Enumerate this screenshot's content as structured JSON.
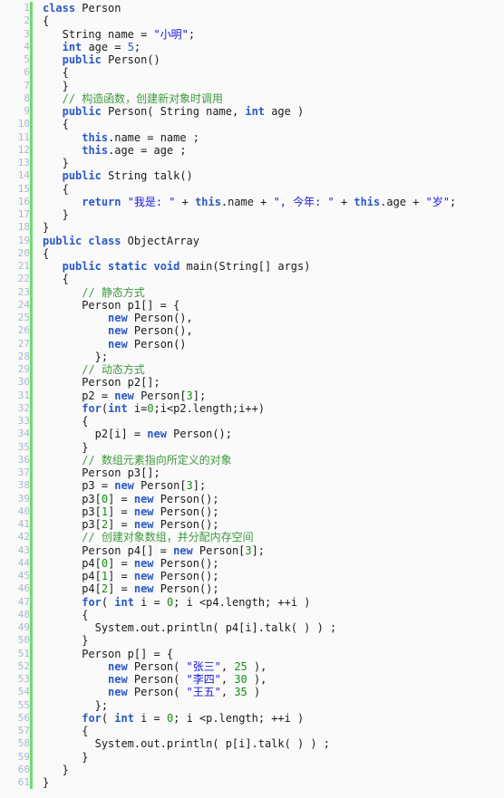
{
  "editor": {
    "file_name": "ObjectArray.java",
    "language": "Java",
    "background_color": "#fafafa",
    "gutter_color": "#a5b6cc",
    "marker_color": "#6ddd6d",
    "keyword_color": "#2a58c8",
    "string_color": "#1818e0",
    "comment_color": "#3c9a3c",
    "number_color": "#109010",
    "plain_color": "#1a1a1a",
    "first_line": 1,
    "last_line": 61,
    "total_lines": 61
  },
  "lines": [
    {
      "n": "1",
      "tokens": [
        {
          "t": "kw",
          "v": "class"
        },
        {
          "t": "pln",
          "v": " Person"
        }
      ]
    },
    {
      "n": "2",
      "tokens": [
        {
          "t": "pln",
          "v": "{"
        }
      ]
    },
    {
      "n": "3",
      "tokens": [
        {
          "t": "pln",
          "v": "   String name = "
        },
        {
          "t": "str",
          "v": "\"小明\""
        },
        {
          "t": "pln",
          "v": ";"
        }
      ]
    },
    {
      "n": "4",
      "tokens": [
        {
          "t": "pln",
          "v": "   "
        },
        {
          "t": "kw",
          "v": "int"
        },
        {
          "t": "pln",
          "v": " age = "
        },
        {
          "t": "numb",
          "v": "5"
        },
        {
          "t": "pln",
          "v": ";"
        }
      ]
    },
    {
      "n": "5",
      "tokens": [
        {
          "t": "pln",
          "v": "   "
        },
        {
          "t": "kw",
          "v": "public"
        },
        {
          "t": "pln",
          "v": " Person()"
        }
      ]
    },
    {
      "n": "6",
      "tokens": [
        {
          "t": "pln",
          "v": "   {"
        }
      ]
    },
    {
      "n": "7",
      "tokens": [
        {
          "t": "pln",
          "v": "   }"
        }
      ]
    },
    {
      "n": "8",
      "tokens": [
        {
          "t": "pln",
          "v": "   "
        },
        {
          "t": "cmt",
          "v": "// 构造函数，创建新对象时调用"
        }
      ]
    },
    {
      "n": "9",
      "tokens": [
        {
          "t": "pln",
          "v": "   "
        },
        {
          "t": "kw",
          "v": "public"
        },
        {
          "t": "pln",
          "v": " Person( String name, "
        },
        {
          "t": "kw",
          "v": "int"
        },
        {
          "t": "pln",
          "v": " age )"
        }
      ]
    },
    {
      "n": "10",
      "tokens": [
        {
          "t": "pln",
          "v": "   {"
        }
      ]
    },
    {
      "n": "11",
      "tokens": [
        {
          "t": "pln",
          "v": "      "
        },
        {
          "t": "kw",
          "v": "this"
        },
        {
          "t": "pln",
          "v": ".name = name ;"
        }
      ]
    },
    {
      "n": "12",
      "tokens": [
        {
          "t": "pln",
          "v": "      "
        },
        {
          "t": "kw",
          "v": "this"
        },
        {
          "t": "pln",
          "v": ".age = age ;"
        }
      ]
    },
    {
      "n": "13",
      "tokens": [
        {
          "t": "pln",
          "v": "   }"
        }
      ]
    },
    {
      "n": "14",
      "tokens": [
        {
          "t": "pln",
          "v": "   "
        },
        {
          "t": "kw",
          "v": "public"
        },
        {
          "t": "pln",
          "v": " String talk()"
        }
      ]
    },
    {
      "n": "15",
      "tokens": [
        {
          "t": "pln",
          "v": "   {"
        }
      ]
    },
    {
      "n": "16",
      "tokens": [
        {
          "t": "pln",
          "v": "      "
        },
        {
          "t": "kw",
          "v": "return"
        },
        {
          "t": "pln",
          "v": " "
        },
        {
          "t": "str",
          "v": "\"我是: \""
        },
        {
          "t": "pln",
          "v": " + "
        },
        {
          "t": "kw",
          "v": "this"
        },
        {
          "t": "pln",
          "v": ".name + "
        },
        {
          "t": "str",
          "v": "\", 今年: \""
        },
        {
          "t": "pln",
          "v": " + "
        },
        {
          "t": "kw",
          "v": "this"
        },
        {
          "t": "pln",
          "v": ".age + "
        },
        {
          "t": "str",
          "v": "\"岁\""
        },
        {
          "t": "pln",
          "v": ";"
        }
      ]
    },
    {
      "n": "17",
      "tokens": [
        {
          "t": "pln",
          "v": "   }"
        }
      ]
    },
    {
      "n": "18",
      "tokens": [
        {
          "t": "pln",
          "v": "}"
        }
      ]
    },
    {
      "n": "19",
      "tokens": [
        {
          "t": "kw",
          "v": "public class"
        },
        {
          "t": "pln",
          "v": " ObjectArray"
        }
      ]
    },
    {
      "n": "20",
      "tokens": [
        {
          "t": "pln",
          "v": "{"
        }
      ]
    },
    {
      "n": "21",
      "tokens": [
        {
          "t": "pln",
          "v": "   "
        },
        {
          "t": "kw",
          "v": "public static void"
        },
        {
          "t": "pln",
          "v": " main(String[] args)"
        }
      ]
    },
    {
      "n": "22",
      "tokens": [
        {
          "t": "pln",
          "v": "   {"
        }
      ]
    },
    {
      "n": "23",
      "tokens": [
        {
          "t": "pln",
          "v": "      "
        },
        {
          "t": "cmt",
          "v": "// 静态方式"
        }
      ]
    },
    {
      "n": "24",
      "tokens": [
        {
          "t": "pln",
          "v": "      Person p1[] = {"
        }
      ]
    },
    {
      "n": "25",
      "tokens": [
        {
          "t": "pln",
          "v": "          "
        },
        {
          "t": "kw",
          "v": "new"
        },
        {
          "t": "pln",
          "v": " Person(),"
        }
      ]
    },
    {
      "n": "26",
      "tokens": [
        {
          "t": "pln",
          "v": "          "
        },
        {
          "t": "kw",
          "v": "new"
        },
        {
          "t": "pln",
          "v": " Person(),"
        }
      ]
    },
    {
      "n": "27",
      "tokens": [
        {
          "t": "pln",
          "v": "          "
        },
        {
          "t": "kw",
          "v": "new"
        },
        {
          "t": "pln",
          "v": " Person()"
        }
      ]
    },
    {
      "n": "28",
      "tokens": [
        {
          "t": "pln",
          "v": "        };"
        }
      ]
    },
    {
      "n": "29",
      "tokens": [
        {
          "t": "pln",
          "v": "      "
        },
        {
          "t": "cmt",
          "v": "// 动态方式"
        }
      ]
    },
    {
      "n": "30",
      "tokens": [
        {
          "t": "pln",
          "v": "      Person p2[];"
        }
      ]
    },
    {
      "n": "31",
      "tokens": [
        {
          "t": "pln",
          "v": "      p2 = "
        },
        {
          "t": "kw",
          "v": "new"
        },
        {
          "t": "pln",
          "v": " Person["
        },
        {
          "t": "num",
          "v": "3"
        },
        {
          "t": "pln",
          "v": "];"
        }
      ]
    },
    {
      "n": "32",
      "tokens": [
        {
          "t": "pln",
          "v": "      "
        },
        {
          "t": "kw",
          "v": "for"
        },
        {
          "t": "pln",
          "v": "("
        },
        {
          "t": "kw",
          "v": "int"
        },
        {
          "t": "pln",
          "v": " i="
        },
        {
          "t": "num",
          "v": "0"
        },
        {
          "t": "pln",
          "v": ";i<p2.length;i++)"
        }
      ]
    },
    {
      "n": "33",
      "tokens": [
        {
          "t": "pln",
          "v": "      {"
        }
      ]
    },
    {
      "n": "34",
      "tokens": [
        {
          "t": "pln",
          "v": "        p2[i] = "
        },
        {
          "t": "kw",
          "v": "new"
        },
        {
          "t": "pln",
          "v": " Person();"
        }
      ]
    },
    {
      "n": "35",
      "tokens": [
        {
          "t": "pln",
          "v": "      }"
        }
      ]
    },
    {
      "n": "36",
      "tokens": [
        {
          "t": "pln",
          "v": "      "
        },
        {
          "t": "cmt",
          "v": "// 数组元素指向所定义的对象"
        }
      ]
    },
    {
      "n": "37",
      "tokens": [
        {
          "t": "pln",
          "v": "      Person p3[];"
        }
      ]
    },
    {
      "n": "38",
      "tokens": [
        {
          "t": "pln",
          "v": "      p3 = "
        },
        {
          "t": "kw",
          "v": "new"
        },
        {
          "t": "pln",
          "v": " Person["
        },
        {
          "t": "num",
          "v": "3"
        },
        {
          "t": "pln",
          "v": "];"
        }
      ]
    },
    {
      "n": "39",
      "tokens": [
        {
          "t": "pln",
          "v": "      p3["
        },
        {
          "t": "num",
          "v": "0"
        },
        {
          "t": "pln",
          "v": "] = "
        },
        {
          "t": "kw",
          "v": "new"
        },
        {
          "t": "pln",
          "v": " Person();"
        }
      ]
    },
    {
      "n": "40",
      "tokens": [
        {
          "t": "pln",
          "v": "      p3["
        },
        {
          "t": "num",
          "v": "1"
        },
        {
          "t": "pln",
          "v": "] = "
        },
        {
          "t": "kw",
          "v": "new"
        },
        {
          "t": "pln",
          "v": " Person();"
        }
      ]
    },
    {
      "n": "41",
      "tokens": [
        {
          "t": "pln",
          "v": "      p3["
        },
        {
          "t": "num",
          "v": "2"
        },
        {
          "t": "pln",
          "v": "] = "
        },
        {
          "t": "kw",
          "v": "new"
        },
        {
          "t": "pln",
          "v": " Person();"
        }
      ]
    },
    {
      "n": "42",
      "tokens": [
        {
          "t": "pln",
          "v": "      "
        },
        {
          "t": "cmt",
          "v": "// 创建对象数组，并分配内存空间"
        }
      ]
    },
    {
      "n": "43",
      "tokens": [
        {
          "t": "pln",
          "v": "      Person p4[] = "
        },
        {
          "t": "kw",
          "v": "new"
        },
        {
          "t": "pln",
          "v": " Person["
        },
        {
          "t": "num",
          "v": "3"
        },
        {
          "t": "pln",
          "v": "];"
        }
      ]
    },
    {
      "n": "44",
      "tokens": [
        {
          "t": "pln",
          "v": "      p4["
        },
        {
          "t": "num",
          "v": "0"
        },
        {
          "t": "pln",
          "v": "] = "
        },
        {
          "t": "kw",
          "v": "new"
        },
        {
          "t": "pln",
          "v": " Person();"
        }
      ]
    },
    {
      "n": "45",
      "tokens": [
        {
          "t": "pln",
          "v": "      p4["
        },
        {
          "t": "num",
          "v": "1"
        },
        {
          "t": "pln",
          "v": "] = "
        },
        {
          "t": "kw",
          "v": "new"
        },
        {
          "t": "pln",
          "v": " Person();"
        }
      ]
    },
    {
      "n": "46",
      "tokens": [
        {
          "t": "pln",
          "v": "      p4["
        },
        {
          "t": "num",
          "v": "2"
        },
        {
          "t": "pln",
          "v": "] = "
        },
        {
          "t": "kw",
          "v": "new"
        },
        {
          "t": "pln",
          "v": " Person();"
        }
      ]
    },
    {
      "n": "47",
      "tokens": [
        {
          "t": "pln",
          "v": "      "
        },
        {
          "t": "kw",
          "v": "for"
        },
        {
          "t": "pln",
          "v": "( "
        },
        {
          "t": "kw",
          "v": "int"
        },
        {
          "t": "pln",
          "v": " i = "
        },
        {
          "t": "num",
          "v": "0"
        },
        {
          "t": "pln",
          "v": "; i <p4.length; ++i )"
        }
      ]
    },
    {
      "n": "48",
      "tokens": [
        {
          "t": "pln",
          "v": "      {"
        }
      ]
    },
    {
      "n": "49",
      "tokens": [
        {
          "t": "pln",
          "v": "        System.out.println( p4[i].talk( ) ) ;"
        }
      ]
    },
    {
      "n": "50",
      "tokens": [
        {
          "t": "pln",
          "v": "      }"
        }
      ]
    },
    {
      "n": "51",
      "tokens": [
        {
          "t": "pln",
          "v": "      Person p[] = {"
        }
      ]
    },
    {
      "n": "52",
      "tokens": [
        {
          "t": "pln",
          "v": "          "
        },
        {
          "t": "kw",
          "v": "new"
        },
        {
          "t": "pln",
          "v": " Person( "
        },
        {
          "t": "str",
          "v": "\"张三\""
        },
        {
          "t": "pln",
          "v": ", "
        },
        {
          "t": "num",
          "v": "25"
        },
        {
          "t": "pln",
          "v": " ),"
        }
      ]
    },
    {
      "n": "53",
      "tokens": [
        {
          "t": "pln",
          "v": "          "
        },
        {
          "t": "kw",
          "v": "new"
        },
        {
          "t": "pln",
          "v": " Person( "
        },
        {
          "t": "str",
          "v": "\"李四\""
        },
        {
          "t": "pln",
          "v": ", "
        },
        {
          "t": "num",
          "v": "30"
        },
        {
          "t": "pln",
          "v": " ),"
        }
      ]
    },
    {
      "n": "54",
      "tokens": [
        {
          "t": "pln",
          "v": "          "
        },
        {
          "t": "kw",
          "v": "new"
        },
        {
          "t": "pln",
          "v": " Person( "
        },
        {
          "t": "str",
          "v": "\"王五\""
        },
        {
          "t": "pln",
          "v": ", "
        },
        {
          "t": "num",
          "v": "35"
        },
        {
          "t": "pln",
          "v": " )"
        }
      ]
    },
    {
      "n": "55",
      "tokens": [
        {
          "t": "pln",
          "v": "        };"
        }
      ]
    },
    {
      "n": "56",
      "tokens": [
        {
          "t": "pln",
          "v": "      "
        },
        {
          "t": "kw",
          "v": "for"
        },
        {
          "t": "pln",
          "v": "( "
        },
        {
          "t": "kw",
          "v": "int"
        },
        {
          "t": "pln",
          "v": " i = "
        },
        {
          "t": "num",
          "v": "0"
        },
        {
          "t": "pln",
          "v": "; i <p.length; ++i )"
        }
      ]
    },
    {
      "n": "57",
      "tokens": [
        {
          "t": "pln",
          "v": "      {"
        }
      ]
    },
    {
      "n": "58",
      "tokens": [
        {
          "t": "pln",
          "v": "        System.out.println( p[i].talk( ) ) ;"
        }
      ]
    },
    {
      "n": "59",
      "tokens": [
        {
          "t": "pln",
          "v": "      }"
        }
      ]
    },
    {
      "n": "60",
      "tokens": [
        {
          "t": "pln",
          "v": "   }"
        }
      ]
    },
    {
      "n": "61",
      "tokens": [
        {
          "t": "pln",
          "v": "}"
        }
      ]
    }
  ]
}
